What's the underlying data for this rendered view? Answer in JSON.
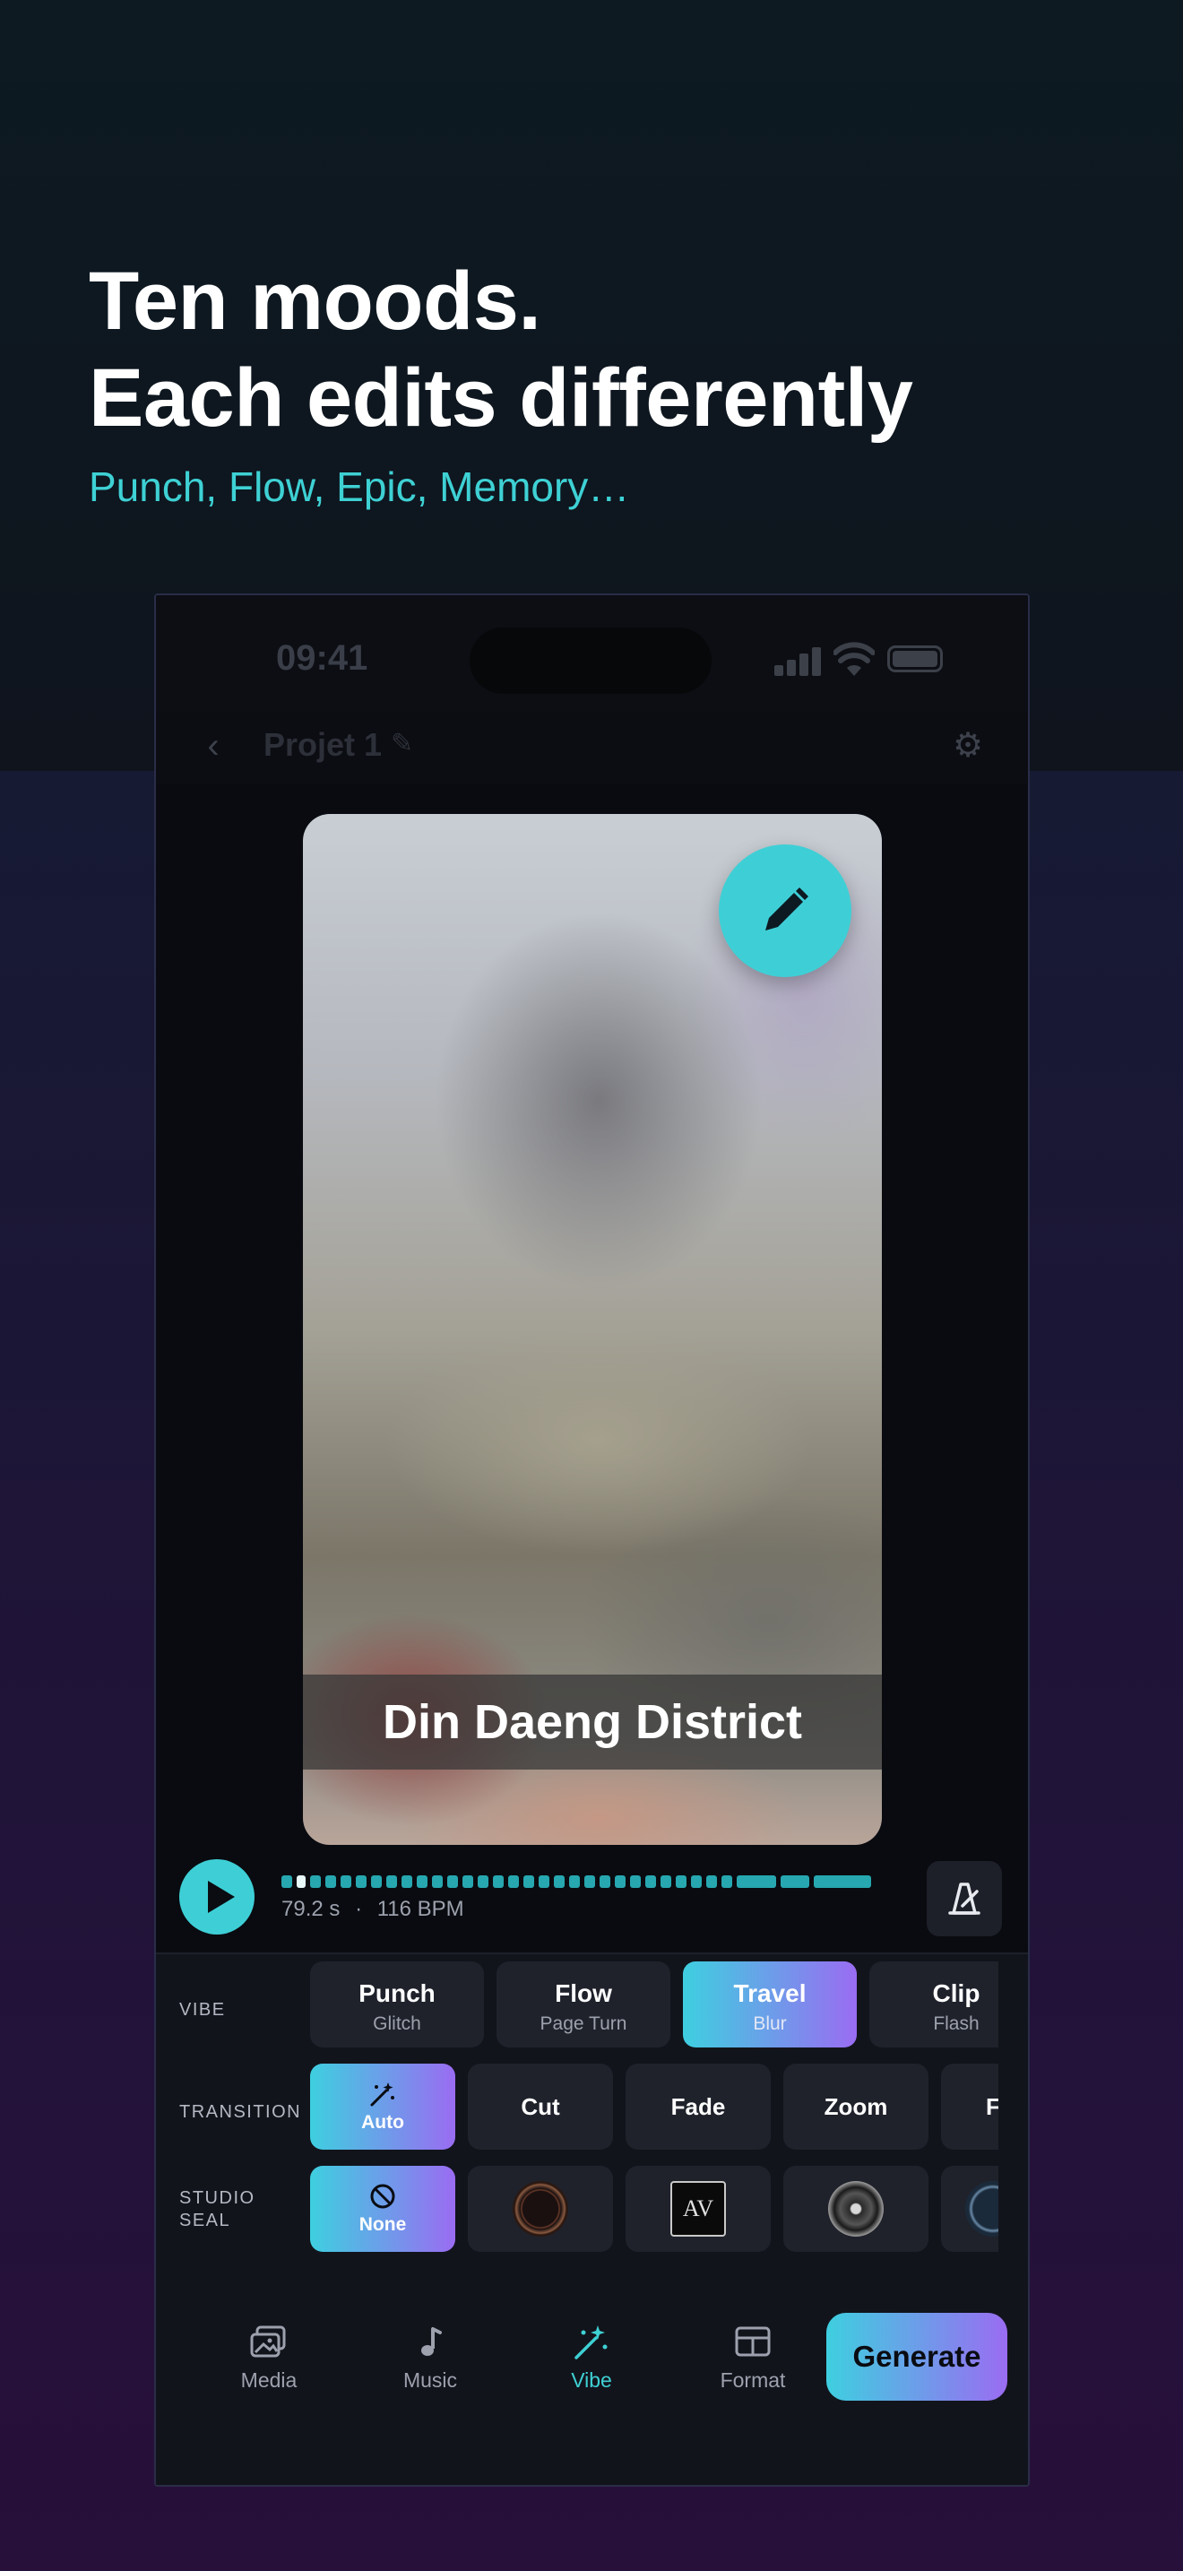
{
  "hero": {
    "headline_line1": "Ten moods.",
    "headline_line2": "Each edits differently",
    "subline": "Punch, Flow, Epic, Memory…"
  },
  "status_bar": {
    "time": "09:41"
  },
  "nav": {
    "back_icon": "chevron-left-icon",
    "project_title": "Projet 1",
    "edit_icon": "pencil-icon",
    "settings_icon": "gear-icon"
  },
  "preview": {
    "caption": "Din Daeng District",
    "edit_button_icon": "pencil-icon"
  },
  "playback": {
    "duration": "79.2 s",
    "separator": "·",
    "bpm": "116 BPM",
    "play_icon": "play-icon",
    "beat_icon": "metronome-icon"
  },
  "vibe": {
    "label": "VIBE",
    "options": [
      {
        "title": "Punch",
        "subtitle": "Glitch",
        "selected": false
      },
      {
        "title": "Flow",
        "subtitle": "Page Turn",
        "selected": false
      },
      {
        "title": "Travel",
        "subtitle": "Blur",
        "selected": true
      },
      {
        "title": "Clip",
        "subtitle": "Flash",
        "selected": false
      }
    ]
  },
  "transition": {
    "label": "TRANSITION",
    "options": [
      "Auto",
      "Cut",
      "Fade",
      "Zoom",
      "Fl"
    ],
    "selected": "Auto"
  },
  "studio_seal": {
    "label_line1": "STUDIO",
    "label_line2": "SEAL",
    "none_label": "None",
    "selected": "None",
    "seal_logo_text": "AV"
  },
  "tab_bar": {
    "tabs": [
      {
        "label": "Media",
        "icon": "photos-icon",
        "active": false
      },
      {
        "label": "Music",
        "icon": "music-note-icon",
        "active": false
      },
      {
        "label": "Vibe",
        "icon": "magic-wand-icon",
        "active": true
      },
      {
        "label": "Format",
        "icon": "layout-icon",
        "active": false
      }
    ],
    "generate_label": "Generate"
  },
  "colors": {
    "accent": "#3ed1d4",
    "gradient_start": "#3ecfe0",
    "gradient_end": "#9a6cf2",
    "background": "#0f141d",
    "panel": "#12141c"
  }
}
